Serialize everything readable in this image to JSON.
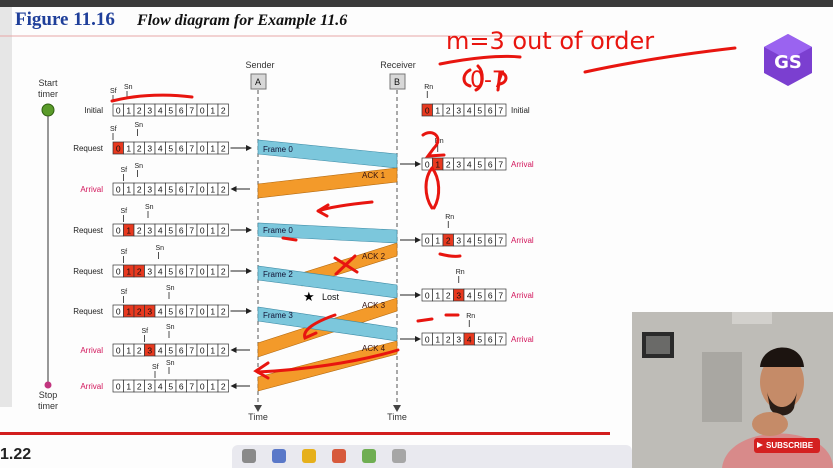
{
  "figure": {
    "number": "Figure 11.16",
    "caption": "Flow diagram for Example 11.6"
  },
  "timeline": {
    "start": "Start timer",
    "start_line1": "Start",
    "start_line2": "timer",
    "stop_line1": "Stop",
    "stop_line2": "timer"
  },
  "sender": {
    "label": "Sender",
    "node": "A"
  },
  "receiver": {
    "label": "Receiver",
    "node": "B"
  },
  "time_label": "Time",
  "sender_events": [
    {
      "label": "Initial",
      "color": "#222222"
    },
    {
      "label": "Request",
      "color": "#222222"
    },
    {
      "label": "Arrival",
      "color": "#d2145a"
    },
    {
      "label": "Request",
      "color": "#222222"
    },
    {
      "label": "Request",
      "color": "#222222"
    },
    {
      "label": "Request",
      "color": "#222222"
    },
    {
      "label": "Arrival",
      "color": "#d2145a"
    },
    {
      "label": "Arrival",
      "color": "#d2145a"
    }
  ],
  "sender_window_digits": [
    "0",
    "1",
    "2",
    "3",
    "4",
    "5",
    "6",
    "7",
    "0",
    "1",
    "2"
  ],
  "receiver_window_digits": [
    "0",
    "1",
    "2",
    "3",
    "4",
    "5",
    "6",
    "7"
  ],
  "receiver_events": [
    {
      "label": "Initial",
      "color": "#222222"
    },
    {
      "label": "Arrival",
      "color": "#d2145a"
    },
    {
      "label": "Arrival",
      "color": "#d2145a"
    },
    {
      "label": "Arrival",
      "color": "#d2145a"
    },
    {
      "label": "Arrival",
      "color": "#d2145a"
    }
  ],
  "pointer_labels": {
    "sf": "Sf",
    "sn": "Sn",
    "rn": "Rn"
  },
  "frames": [
    {
      "label": "Frame 0"
    },
    {
      "label": "Frame 1"
    },
    {
      "label": "Frame 2"
    },
    {
      "label": "Frame 3"
    }
  ],
  "acks": [
    {
      "label": "ACK 1"
    },
    {
      "label": "ACK 2"
    },
    {
      "label": "ACK 3"
    },
    {
      "label": "ACK 4"
    }
  ],
  "lost_label": "Lost",
  "annotation": {
    "text": "m=3 out of order",
    "sub": "0-7"
  },
  "bottom_page": "1.22",
  "subscribe": "SUBSCRIBE",
  "colors": {
    "frame": "#7cc7dc",
    "ack": "#f39a2a",
    "highlight": "#e8391f",
    "pen": "#e8150f",
    "arrival": "#d2145a",
    "title": "#1f3f9a"
  }
}
